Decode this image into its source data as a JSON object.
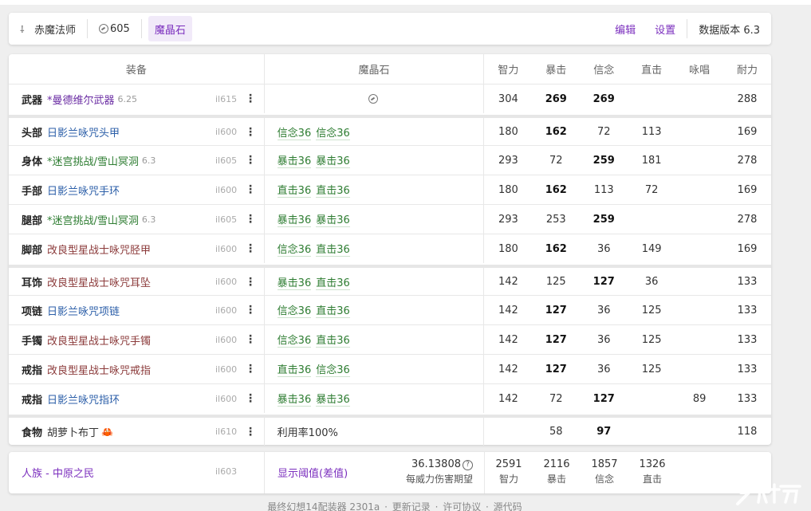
{
  "header": {
    "job": "赤魔法师",
    "level_value": "605",
    "materia_tab": "魔晶石",
    "edit": "编辑",
    "settings": "设置",
    "data_version": "数据版本 6.3"
  },
  "columns": {
    "gear": "装备",
    "materia": "魔晶石",
    "stats": [
      "智力",
      "暴击",
      "信念",
      "直击",
      "咏唱",
      "耐力"
    ]
  },
  "rows": [
    {
      "slot": "武器",
      "name": "*曼德维尔武器",
      "ver": "6.25",
      "il": "il615",
      "color": "purple",
      "materia": [],
      "stats": [
        "304",
        "269",
        "269",
        "",
        "",
        "288"
      ],
      "bold": [
        1,
        2
      ]
    },
    {
      "slot": "头部",
      "name": "日影兰咏咒头甲",
      "ver": "",
      "il": "il600",
      "color": "blue",
      "materia": [
        "信念36",
        "信念36"
      ],
      "stats": [
        "180",
        "162",
        "72",
        "113",
        "",
        "169"
      ],
      "bold": [
        1
      ]
    },
    {
      "slot": "身体",
      "name": "*迷宫挑战/雪山冥洞",
      "ver": "6.3",
      "il": "il605",
      "color": "green",
      "materia": [
        "暴击36",
        "暴击36"
      ],
      "stats": [
        "293",
        "72",
        "259",
        "181",
        "",
        "278"
      ],
      "bold": [
        2
      ]
    },
    {
      "slot": "手部",
      "name": "日影兰咏咒手环",
      "ver": "",
      "il": "il600",
      "color": "blue",
      "materia": [
        "直击36",
        "直击36"
      ],
      "stats": [
        "180",
        "162",
        "113",
        "72",
        "",
        "169"
      ],
      "bold": [
        1
      ]
    },
    {
      "slot": "腿部",
      "name": "*迷宫挑战/雪山冥洞",
      "ver": "6.3",
      "il": "il605",
      "color": "green",
      "materia": [
        "暴击36",
        "暴击36"
      ],
      "stats": [
        "293",
        "253",
        "259",
        "",
        "",
        "278"
      ],
      "bold": [
        2
      ]
    },
    {
      "slot": "脚部",
      "name": "改良型星战士咏咒胫甲",
      "ver": "",
      "il": "il600",
      "color": "brown",
      "materia": [
        "信念36",
        "直击36"
      ],
      "stats": [
        "180",
        "162",
        "36",
        "149",
        "",
        "169"
      ],
      "bold": [
        1
      ]
    },
    {
      "slot": "耳饰",
      "name": "改良型星战士咏咒耳坠",
      "ver": "",
      "il": "il600",
      "color": "brown",
      "materia": [
        "暴击36",
        "直击36"
      ],
      "stats": [
        "142",
        "125",
        "127",
        "36",
        "",
        "133"
      ],
      "bold": [
        2
      ]
    },
    {
      "slot": "项链",
      "name": "日影兰咏咒项链",
      "ver": "",
      "il": "il600",
      "color": "blue",
      "materia": [
        "信念36",
        "直击36"
      ],
      "stats": [
        "142",
        "127",
        "36",
        "125",
        "",
        "133"
      ],
      "bold": [
        1
      ]
    },
    {
      "slot": "手镯",
      "name": "改良型星战士咏咒手镯",
      "ver": "",
      "il": "il600",
      "color": "brown",
      "materia": [
        "信念36",
        "直击36"
      ],
      "stats": [
        "142",
        "127",
        "36",
        "125",
        "",
        "133"
      ],
      "bold": [
        1
      ]
    },
    {
      "slot": "戒指",
      "name": "改良型星战士咏咒戒指",
      "ver": "",
      "il": "il600",
      "color": "brown",
      "materia": [
        "直击36",
        "信念36"
      ],
      "stats": [
        "142",
        "127",
        "36",
        "125",
        "",
        "133"
      ],
      "bold": [
        1
      ]
    },
    {
      "slot": "戒指",
      "name": "日影兰咏咒指环",
      "ver": "",
      "il": "il600",
      "color": "blue",
      "materia": [
        "暴击36",
        "暴击36"
      ],
      "stats": [
        "142",
        "72",
        "127",
        "",
        "89",
        "133"
      ],
      "bold": [
        2
      ]
    },
    {
      "slot": "食物",
      "name": "胡萝卜布丁",
      "ver": "",
      "il": "il610",
      "color": "dark",
      "materia_text": "利用率100%",
      "materia": [],
      "stats": [
        "",
        "58",
        "97",
        "",
        "",
        "118"
      ],
      "bold": [
        2
      ]
    }
  ],
  "footer": {
    "race": "人族 - 中原之民",
    "il": "il603",
    "threshold": "显示阈值(差值)",
    "dps_value": "36.13808",
    "dps_label": "每威力伤害期望",
    "totals": [
      {
        "value": "2591",
        "label": "智力"
      },
      {
        "value": "2116",
        "label": "暴击"
      },
      {
        "value": "1857",
        "label": "信念"
      },
      {
        "value": "1326",
        "label": "直击"
      }
    ]
  },
  "bottom_bar": {
    "title": "最终幻想14配装器 2301a",
    "changelog": "更新记录",
    "license": "许可协议",
    "source": "源代码"
  }
}
